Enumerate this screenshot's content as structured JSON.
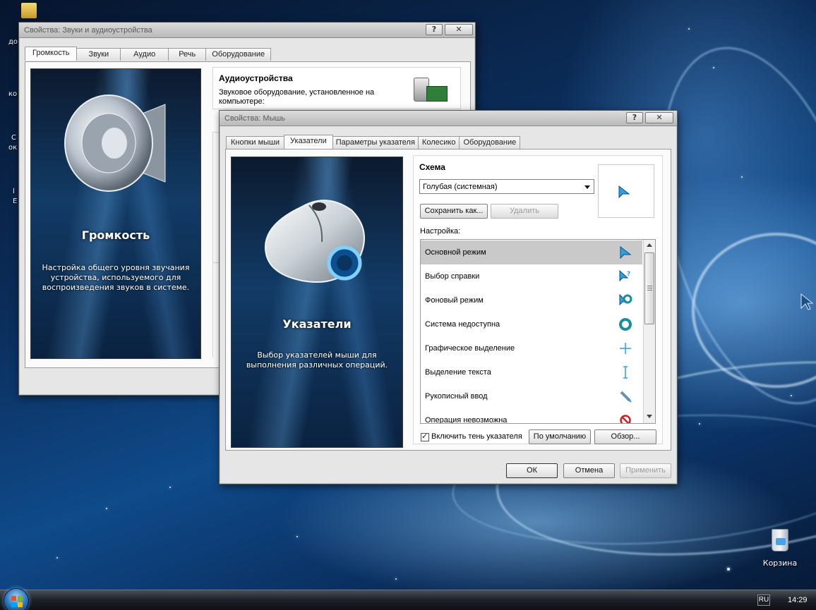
{
  "desktop": {
    "recycle_bin_label": "Корзина",
    "edge_fragments": [
      "до",
      "ко",
      "С",
      "ок",
      "I",
      "E"
    ]
  },
  "sound_window": {
    "title": "Свойства: Звуки и аудиоустройства",
    "help_btn": "?",
    "close_btn": "✕",
    "tabs": [
      "Громкость",
      "Звуки",
      "Аудио",
      "Речь",
      "Оборудование"
    ],
    "panel_title": "Громкость",
    "panel_desc": "Настройка общего уровня звучания устройства, используемого для воспроизведения звуков в системе.",
    "section_title": "Аудиоустройства",
    "section_desc": "Звуковое оборудование, установленное на компьютере:"
  },
  "mouse_window": {
    "title": "Свойства: Мышь",
    "help_btn": "?",
    "close_btn": "✕",
    "tabs": [
      "Кнопки мыши",
      "Указатели",
      "Параметры указателя",
      "Колесико",
      "Оборудование"
    ],
    "active_tab": 1,
    "panel_title": "Указатели",
    "panel_desc": "Выбор указателей мыши для выполнения различных операций.",
    "scheme_label": "Схема",
    "scheme_value": "Голубая (системная)",
    "save_as_btn": "Сохранить как...",
    "delete_btn": "Удалить",
    "customize_label": "Настройка:",
    "pointers": [
      {
        "label": "Основной режим",
        "icon": "arrow-cursor-icon"
      },
      {
        "label": "Выбор справки",
        "icon": "help-cursor-icon"
      },
      {
        "label": "Фоновый режим",
        "icon": "working-background-cursor-icon"
      },
      {
        "label": "Система недоступна",
        "icon": "busy-cursor-icon"
      },
      {
        "label": "Графическое выделение",
        "icon": "precision-cursor-icon"
      },
      {
        "label": "Выделение текста",
        "icon": "text-cursor-icon"
      },
      {
        "label": "Рукописный ввод",
        "icon": "handwriting-cursor-icon"
      },
      {
        "label": "Операция невозможна",
        "icon": "unavailable-cursor-icon"
      }
    ],
    "shadow_checkbox_label": "Включить тень указателя",
    "shadow_checked": true,
    "default_btn": "По умолчанию",
    "browse_btn": "Обзор...",
    "ok_btn": "ОК",
    "cancel_btn": "Отмена",
    "apply_btn": "Применить"
  },
  "taskbar": {
    "language": "RU",
    "time": "14:29"
  },
  "colors": {
    "selection": "#c9c9c9",
    "cursor_blue": "#2f9fe0",
    "unavailable_red": "#d02020"
  }
}
